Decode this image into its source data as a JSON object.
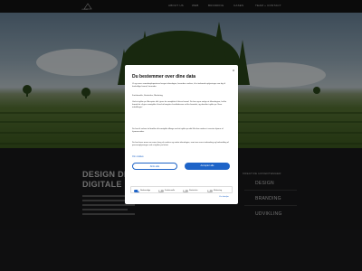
{
  "header": {
    "logo_text": "LAMBA",
    "nav": [
      "ABOUT US",
      "WEB",
      "BRANDING",
      "CASES",
      "TEAM + CONTACT"
    ]
  },
  "main": {
    "headline_1": "DESIGN DI",
    "headline_2": "DIGITALE F",
    "services_caption": "KREATIVE HOVEDTEMAER",
    "services": [
      "DESIGN",
      "BRANDING",
      "UDVIKLING"
    ]
  },
  "consent": {
    "close": "x",
    "title": "Du bestemmer over dine data",
    "intro": "Vi og vores samarbejdspartnere bruger teknologier, herunder cookies, til at indsamle oplysninger om dig til forskellige formål, herunder:",
    "purposes": "Funktionelle, Statistiske, Marketing",
    "body_1": "Ved at trykke på 'Accepter alle' giver du samtykke til disse formål. Du kan også vælge at tilkendegive, hvilke formål du vil give samtykke til ved at benytte checkboksene ud for formålet, og derefter trykke på 'Gem indstillinger'.",
    "body_2": "Du kan til enhver tid trække dit samtykke tilbage ved at trykke på det lille ikon nederst i venstre hjørne af hjemmesiden.",
    "body_3": "Du kan læse mere om vores brug af cookies og andre teknologier, samt om vores indsamling og behandling af personoplysninger ved at trykke på linket.",
    "link": "Om cookies",
    "deny_label": "Afvis alle",
    "accept_label": "Accepter alle",
    "toggles": [
      {
        "label": "Nødvendige",
        "on": true
      },
      {
        "label": "Funktionelle",
        "on": false
      },
      {
        "label": "Statistiske",
        "on": false
      },
      {
        "label": "Marketing",
        "on": false
      }
    ],
    "details_link": "Vis detaljer"
  }
}
